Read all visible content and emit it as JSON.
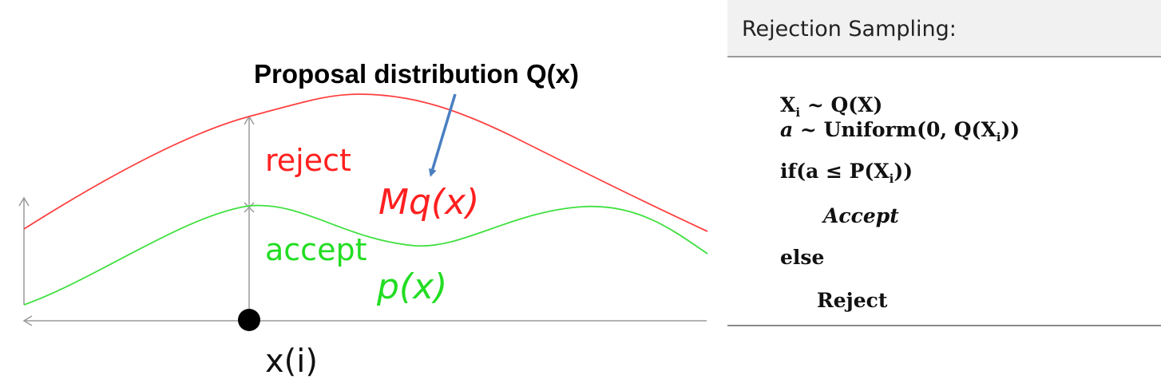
{
  "diagram": {
    "proposal_title": "Proposal distribution Q(x)",
    "reject_label": "reject",
    "accept_label": "accept",
    "mq_label": "Mq(x)",
    "p_label": "p(x)",
    "x_label": "x(i)",
    "colors": {
      "mq_curve": "#ff4040",
      "p_curve": "#40e040",
      "reject_text": "#ff2020",
      "accept_text": "#22dd22",
      "arrow": "#4a7fc1",
      "axis": "#999999"
    }
  },
  "algorithm": {
    "title": "Rejection Sampling:",
    "lines": [
      {
        "id": "sample",
        "text": "Xi ~ Q(X)"
      },
      {
        "id": "uniform",
        "text": "a ~ Uniform(0, Q(Xi))"
      },
      {
        "id": "if",
        "text": "if(a ≤ P(Xi))"
      },
      {
        "id": "accept",
        "text": "Accept"
      },
      {
        "id": "else",
        "text": "else"
      },
      {
        "id": "reject",
        "text": "Reject"
      }
    ],
    "tokens": {
      "X": "X",
      "i": "i",
      "tilde": "~",
      "QX": "Q(X)",
      "a": "a",
      "uniform_open": "Uniform(0, Q(X",
      "close2": "))",
      "if_open": "if(a ≤ P(X",
      "close1": "))",
      "accept": "Accept",
      "else": "else",
      "reject": "Reject"
    }
  }
}
